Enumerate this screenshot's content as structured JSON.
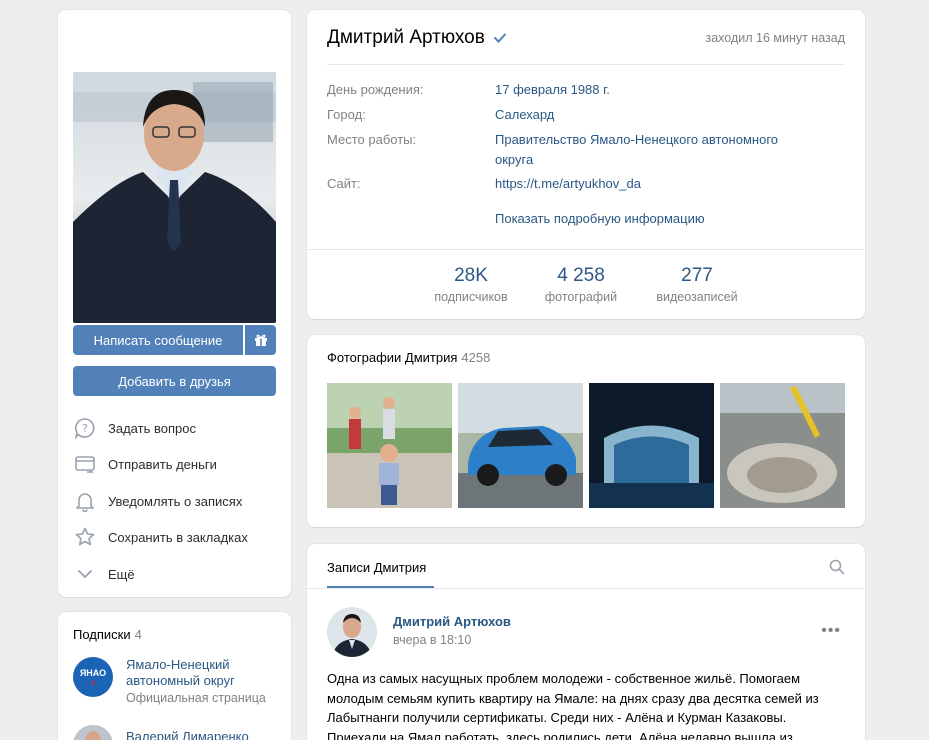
{
  "profile": {
    "name": "Дмитрий Артюхов",
    "verified_icon": "verified-check-icon",
    "last_seen": "заходил 16 минут назад",
    "info": [
      {
        "key": "День рождения:",
        "value": "17 февраля 1988 г."
      },
      {
        "key": "Город:",
        "value": "Салехард"
      },
      {
        "key": "Место работы:",
        "value": "Правительство Ямало-Ненецкого автономного округа"
      },
      {
        "key": "Сайт:",
        "value": "https://t.me/artyukhov_da"
      }
    ],
    "show_more": "Показать подробную информацию",
    "stats": [
      {
        "num": "28K",
        "label": "подписчиков"
      },
      {
        "num": "4 258",
        "label": "фотографий"
      },
      {
        "num": "277",
        "label": "видеозаписей"
      }
    ]
  },
  "actions": {
    "message_button": "Написать сообщение",
    "add_friend_button": "Добавить в друзья",
    "items": [
      {
        "icon": "question-bubble-icon",
        "label": "Задать вопрос"
      },
      {
        "icon": "money-transfer-icon",
        "label": "Отправить деньги"
      },
      {
        "icon": "bell-icon",
        "label": "Уведомлять о записях"
      },
      {
        "icon": "star-icon",
        "label": "Сохранить в закладках"
      },
      {
        "icon": "chevron-down-icon",
        "label": "Ещё"
      }
    ]
  },
  "subscriptions": {
    "title": "Подписки",
    "count": "4",
    "items": [
      {
        "name": "Ямало-Ненецкий автономный округ",
        "desc": "Официальная страница",
        "logo_text": "ЯНАО"
      },
      {
        "name": "Валерий Лимаренко",
        "desc": ""
      }
    ]
  },
  "photos": {
    "title": "Фотографии Дмитрия",
    "count": "4258"
  },
  "wall": {
    "tab": "Записи Дмитрия",
    "post": {
      "author": "Дмитрий Артюхов",
      "time": "вчера в 18:10",
      "text": "Одна из самых насущных проблем молодежи - собственное жильё. Помогаем молодым семьям купить квартиру на Ямале: на днях сразу два десятка семей из Лабытнанги получили сертификаты. Среди них - Алёна и Курман Казаковы. Приехали на Ямал работать, здесь родились дети. Алёна недавно вышла из"
    }
  },
  "colors": {
    "accent": "#5181b8",
    "link": "#2a5885",
    "muted": "#828282",
    "background": "#edeef0"
  }
}
